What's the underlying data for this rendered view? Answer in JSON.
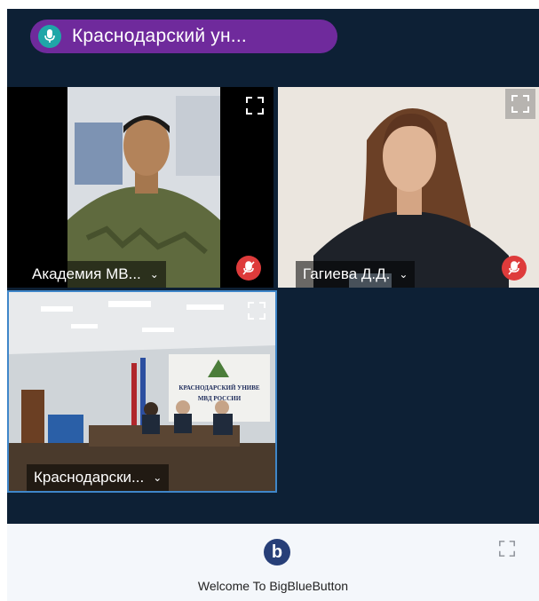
{
  "talking_indicator": {
    "label": "Краснодарский ун..."
  },
  "tiles": [
    {
      "name": "Академия МВ..."
    },
    {
      "name": "Гагиева Д.Д."
    },
    {
      "name": "Краснодарски..."
    }
  ],
  "room_sign": {
    "line1": "КРАСНОДАРСКИЙ УНИВЕ",
    "line2": "МВД РОССИИ"
  },
  "footer": {
    "logo_glyph": "b",
    "welcome": "Welcome To BigBlueButton"
  },
  "colors": {
    "background": "#0d2035",
    "talking_pill": "#6f2a9c",
    "mute_badge": "#de3b3b",
    "focus_border": "#3f86c9"
  }
}
